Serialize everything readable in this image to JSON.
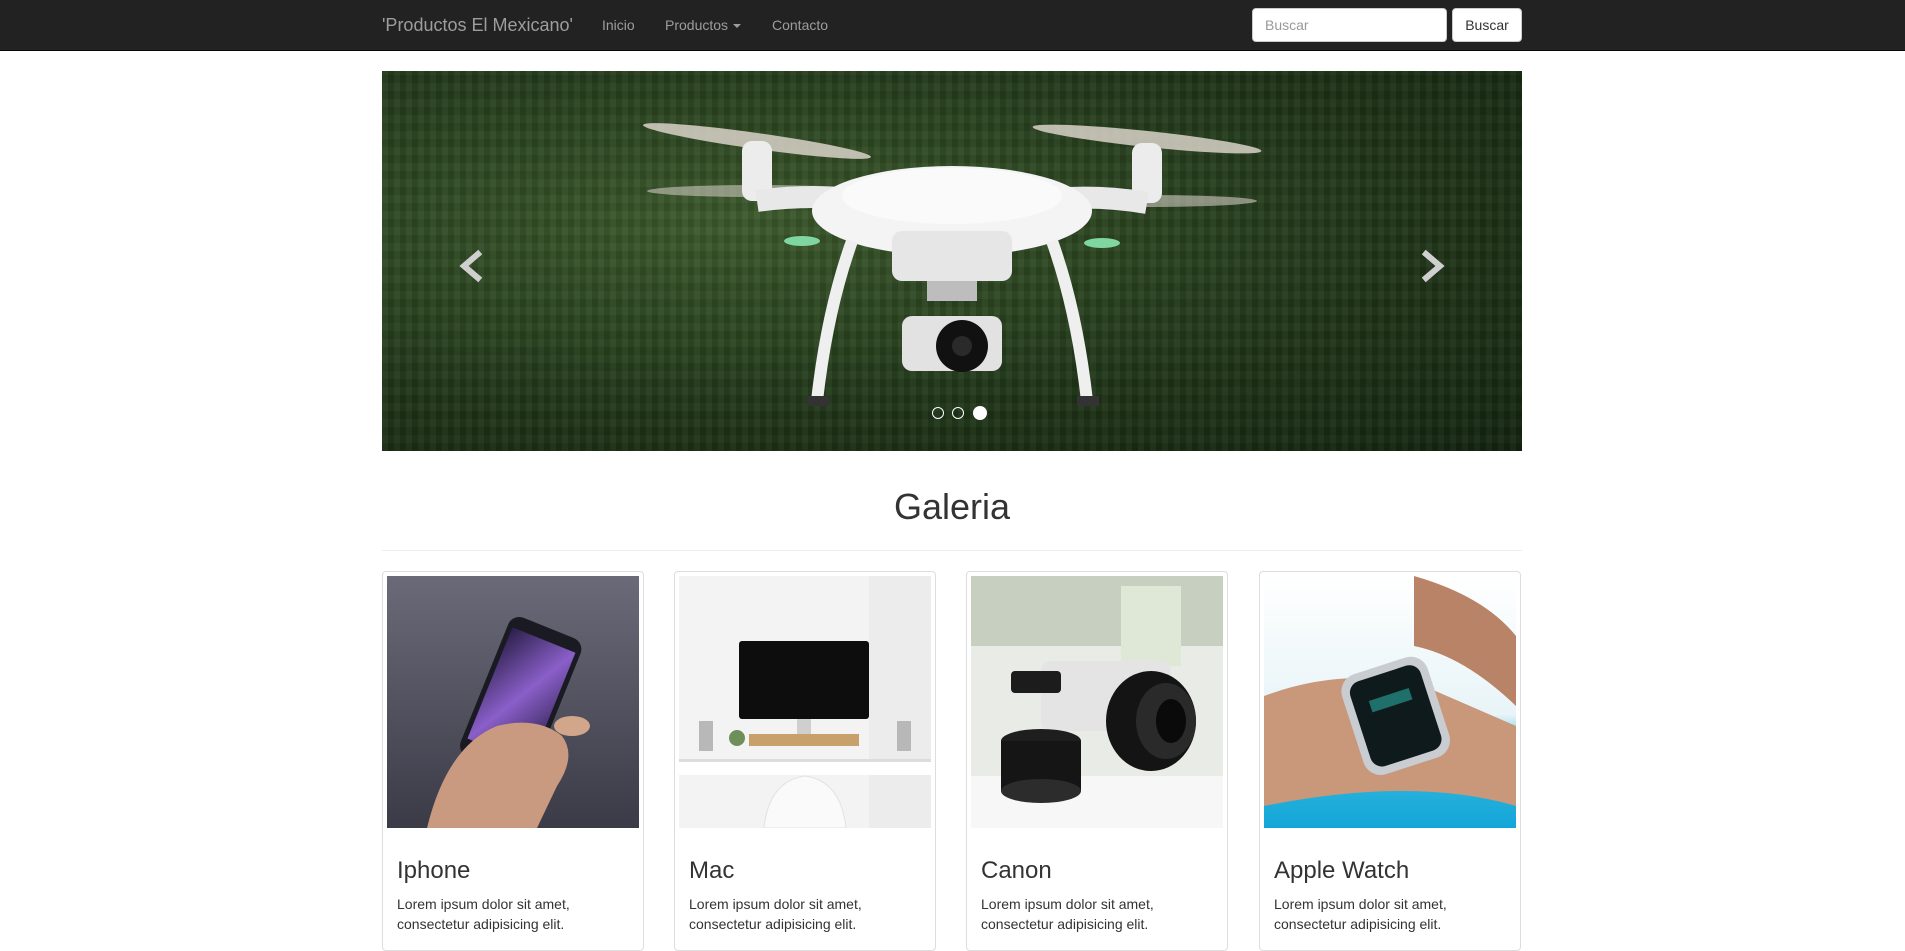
{
  "navbar": {
    "brand": "'Productos El Mexicano'",
    "links": [
      "Inicio",
      "Productos",
      "Contacto"
    ],
    "search_placeholder": "Buscar",
    "search_button": "Buscar"
  },
  "carousel": {
    "slide_count": 3,
    "active_slide": 3,
    "prev_icon": "chevron-left-icon",
    "next_icon": "chevron-right-icon",
    "colors": {
      "forest": "#2a4420",
      "drone": "#f2f2f2"
    }
  },
  "gallery": {
    "title": "Galeria",
    "cards": [
      {
        "title": "Iphone",
        "text": "Lorem ipsum dolor sit amet, consectetur adipisicing elit."
      },
      {
        "title": "Mac",
        "text": "Lorem ipsum dolor sit amet, consectetur adipisicing elit."
      },
      {
        "title": "Canon",
        "text": "Lorem ipsum dolor sit amet, consectetur adipisicing elit."
      },
      {
        "title": "Apple Watch",
        "text": "Lorem ipsum dolor sit amet, consectetur adipisicing elit."
      }
    ]
  },
  "colors": {
    "navbar_bg": "#222222",
    "nav_text": "#9d9d9d",
    "body_text": "#333333"
  }
}
